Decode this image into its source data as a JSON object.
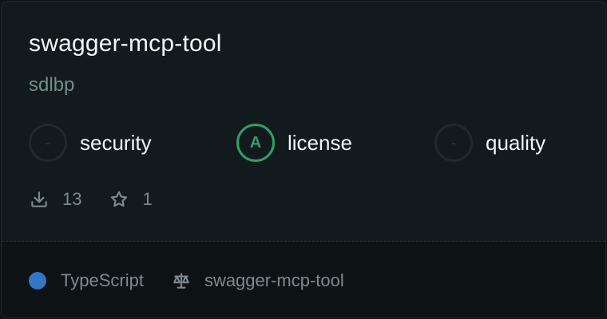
{
  "card": {
    "title": "swagger-mcp-tool",
    "owner": "sdlbp"
  },
  "scores": [
    {
      "badge": "-",
      "label": "security",
      "active": false
    },
    {
      "badge": "A",
      "label": "license",
      "active": true
    },
    {
      "badge": "-",
      "label": "quality",
      "active": false
    }
  ],
  "stats": {
    "downloads": "13",
    "stars": "1",
    "download_icon": "download-icon",
    "star_icon": "star-icon"
  },
  "footer": {
    "language": "TypeScript",
    "language_color": "#3177c6",
    "license_icon": "scale-icon",
    "repo": "swagger-mcp-tool"
  }
}
